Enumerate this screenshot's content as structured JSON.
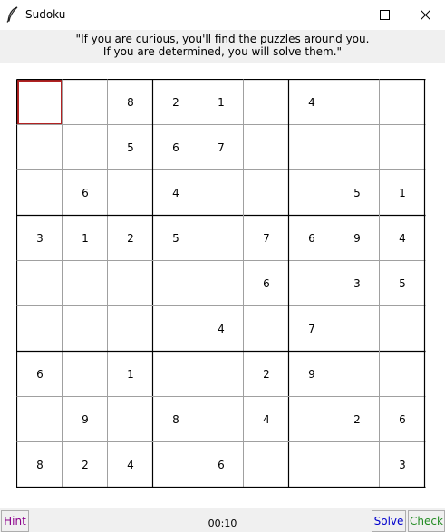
{
  "window": {
    "title": "Sudoku",
    "icon": "feather-icon"
  },
  "quote": {
    "line1": "\"If you are curious, you'll find the puzzles around you.",
    "line2": "If you are determined, you will solve them.\""
  },
  "board": {
    "selected": [
      0,
      0
    ],
    "rows": [
      [
        "",
        "",
        "8",
        "2",
        "1",
        "",
        "4",
        "",
        ""
      ],
      [
        "",
        "",
        "5",
        "6",
        "7",
        "",
        "",
        "",
        ""
      ],
      [
        "",
        "6",
        "",
        "4",
        "",
        "",
        "",
        "5",
        "1"
      ],
      [
        "3",
        "1",
        "2",
        "5",
        "",
        "7",
        "6",
        "9",
        "4"
      ],
      [
        "",
        "",
        "",
        "",
        "",
        "6",
        "",
        "3",
        "5"
      ],
      [
        "",
        "",
        "",
        "",
        "4",
        "",
        "7",
        "",
        ""
      ],
      [
        "6",
        "",
        "1",
        "",
        "",
        "2",
        "9",
        "",
        ""
      ],
      [
        "",
        "9",
        "",
        "8",
        "",
        "4",
        "",
        "2",
        "6"
      ],
      [
        "8",
        "2",
        "4",
        "",
        "6",
        "",
        "",
        "",
        "3"
      ]
    ]
  },
  "footer": {
    "hint_label": "Hint",
    "timer": "00:10",
    "solve_label": "Solve",
    "check_label": "Check"
  },
  "colors": {
    "hint": "#8b008b",
    "solve": "#0000cd",
    "check": "#228b22",
    "selected_outline": "#b22222"
  }
}
